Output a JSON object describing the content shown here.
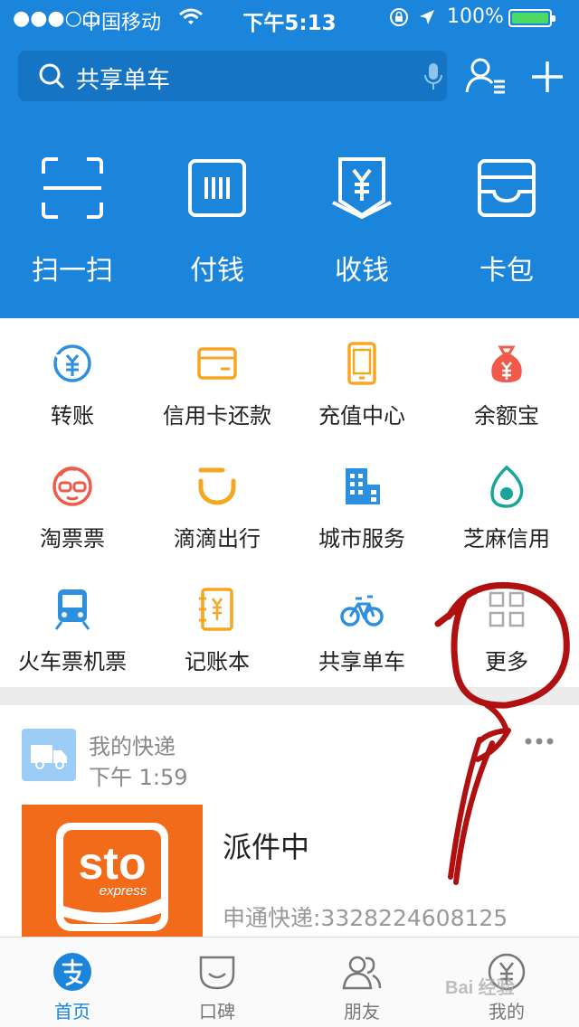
{
  "status_bar": {
    "signal": "●●●○○",
    "carrier": "中国移动",
    "time": "下午5:13",
    "battery": "100%"
  },
  "search": {
    "placeholder": "共享单车",
    "icon": "search-icon"
  },
  "header_actions": [
    {
      "label": "扫一扫",
      "icon": "scan-icon"
    },
    {
      "label": "付钱",
      "icon": "pay-barcode-icon"
    },
    {
      "label": "收钱",
      "icon": "receive-money-icon"
    },
    {
      "label": "卡包",
      "icon": "card-wallet-icon"
    }
  ],
  "grid": [
    {
      "label": "转账",
      "icon": "transfer-icon"
    },
    {
      "label": "信用卡还款",
      "icon": "credit-card-icon"
    },
    {
      "label": "充值中心",
      "icon": "phone-topup-icon"
    },
    {
      "label": "余额宝",
      "icon": "money-bag-icon"
    },
    {
      "label": "淘票票",
      "icon": "movie-ticket-icon"
    },
    {
      "label": "滴滴出行",
      "icon": "didi-icon"
    },
    {
      "label": "城市服务",
      "icon": "city-building-icon"
    },
    {
      "label": "芝麻信用",
      "icon": "sesame-credit-icon"
    },
    {
      "label": "火车票机票",
      "icon": "train-icon"
    },
    {
      "label": "记账本",
      "icon": "ledger-icon"
    },
    {
      "label": "共享单车",
      "icon": "bike-icon"
    },
    {
      "label": "更多",
      "icon": "more-grid-icon"
    }
  ],
  "express_card": {
    "title": "我的快递",
    "time": "下午 1:59",
    "logo_text": "sto",
    "logo_sub": "express",
    "status": "派件中",
    "tracking": "申通快递:3328224608125"
  },
  "tabs": [
    {
      "label": "首页",
      "icon": "alipay-home-icon",
      "active": true
    },
    {
      "label": "口碑",
      "icon": "koubei-icon",
      "active": false
    },
    {
      "label": "朋友",
      "icon": "friends-icon",
      "active": false
    },
    {
      "label": "我的",
      "icon": "my-account-icon",
      "active": false
    }
  ],
  "watermark": "Bai 经验",
  "colors": {
    "brand_blue": "#1a85db",
    "icon_blue": "#2d8fe0",
    "icon_orange": "#f5a623",
    "icon_red": "#f05a4a",
    "icon_green": "#1aa59a",
    "annotation_red": "#b01010"
  }
}
